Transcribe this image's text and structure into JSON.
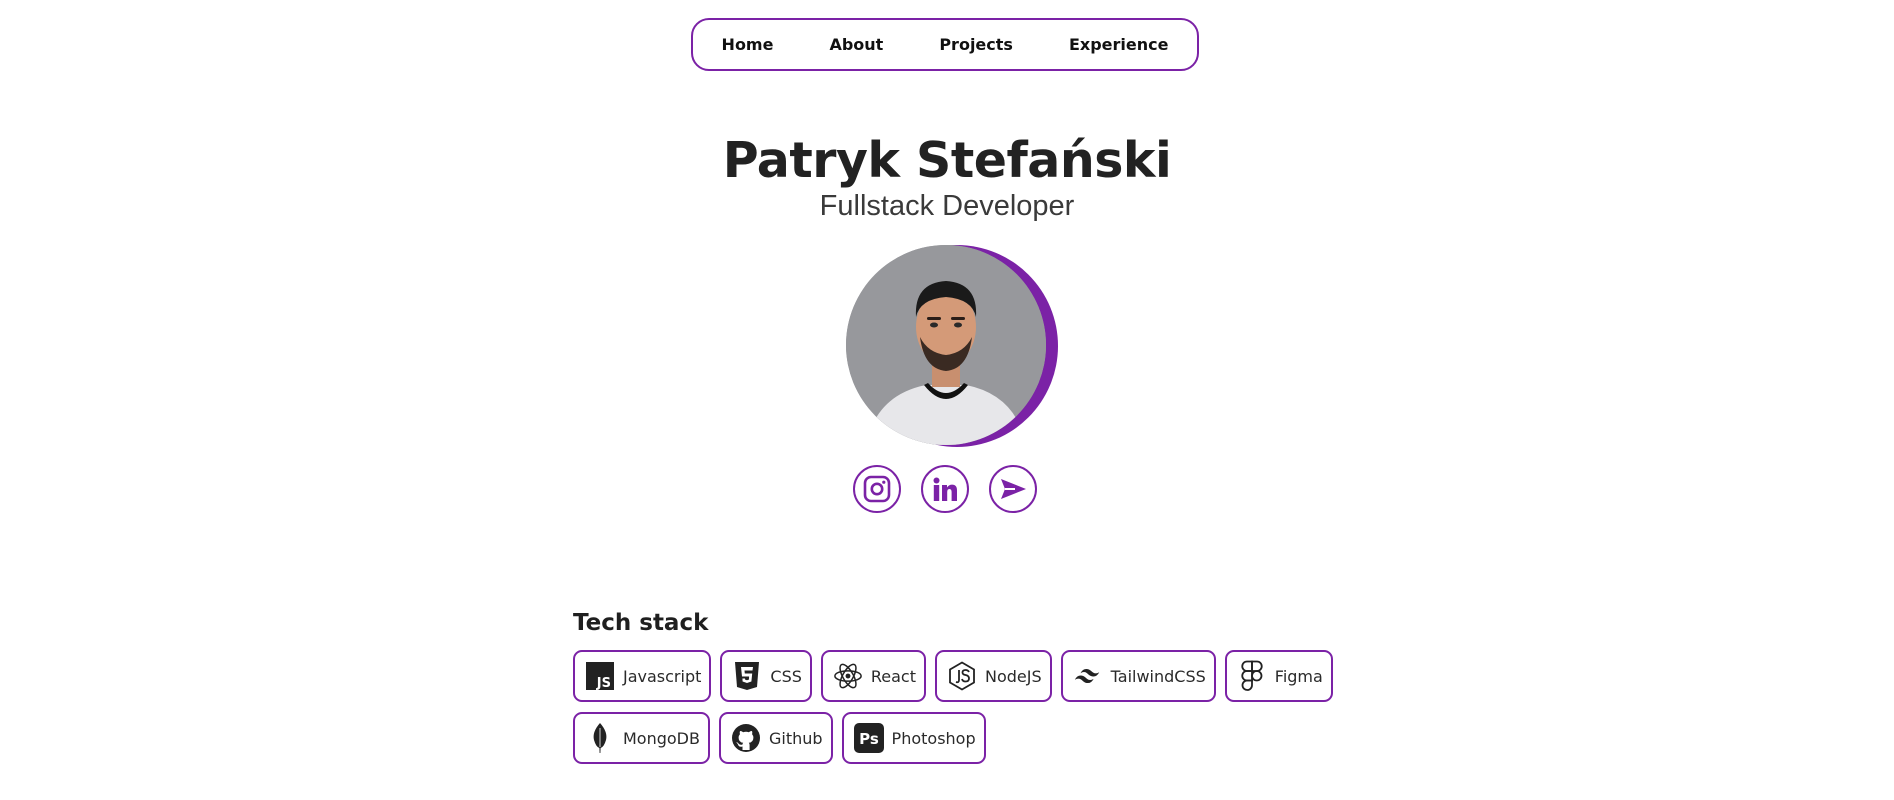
{
  "nav": {
    "items": [
      {
        "label": "Home"
      },
      {
        "label": "About"
      },
      {
        "label": "Projects"
      },
      {
        "label": "Experience"
      }
    ]
  },
  "hero": {
    "name": "Patryk Stefański",
    "role": "Fullstack Developer"
  },
  "socials": [
    {
      "icon": "instagram-icon"
    },
    {
      "icon": "linkedin-icon"
    },
    {
      "icon": "send-icon"
    }
  ],
  "tech_stack": {
    "title": "Tech stack",
    "items": [
      {
        "label": "Javascript",
        "icon": "javascript-icon"
      },
      {
        "label": "CSS",
        "icon": "css3-icon"
      },
      {
        "label": "React",
        "icon": "react-icon"
      },
      {
        "label": "NodeJS",
        "icon": "nodejs-icon"
      },
      {
        "label": "TailwindCSS",
        "icon": "tailwindcss-icon"
      },
      {
        "label": "Figma",
        "icon": "figma-icon"
      },
      {
        "label": "MongoDB",
        "icon": "mongodb-icon"
      },
      {
        "label": "Github",
        "icon": "github-icon"
      },
      {
        "label": "Photoshop",
        "icon": "photoshop-icon"
      }
    ]
  },
  "colors": {
    "accent": "#7b22a6",
    "text": "#1f1f1f",
    "background": "#ffffff"
  }
}
